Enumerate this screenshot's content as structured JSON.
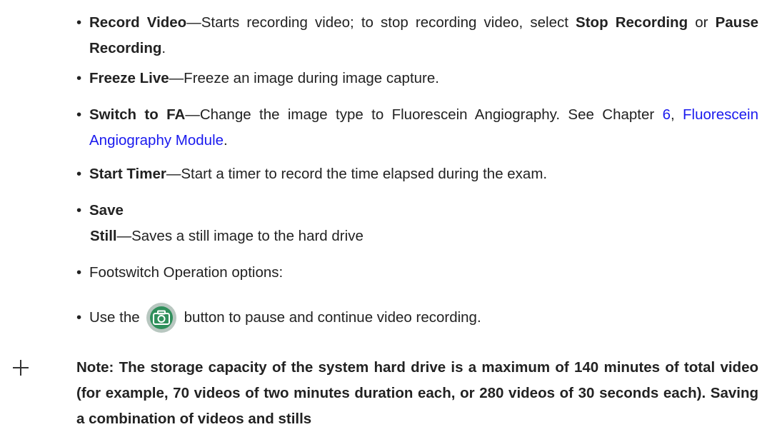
{
  "bullet_glyph": "•",
  "items": [
    {
      "term": "Record Video",
      "dash": "—",
      "text_1": "Starts recording video; to stop recording video, select ",
      "bold_1": "Stop Recording",
      "text_2": " or ",
      "bold_2": "Pause Recording",
      "text_3": "."
    },
    {
      "term": "Freeze Live",
      "dash": "—",
      "text": "Freeze an image during image capture."
    },
    {
      "term": "Switch to FA",
      "dash": "—",
      "text_1": "Change the image type to Fluorescein Angiography. See Chapter ",
      "link_chapter": "6",
      "text_2": ", ",
      "link_title": "Fluorescein Angiography Module",
      "text_3": ".",
      "link_color": "#1a1aee"
    },
    {
      "term": "Start Timer",
      "dash": "—",
      "text": "Start a timer to record the time elapsed during the exam."
    },
    {
      "term_line_1": "Save",
      "term_line_2": "Still",
      "dash": "—",
      "text": "Saves a still image to the hard drive"
    },
    {
      "text": "Footswitch Operation options:"
    }
  ],
  "sub_items": [
    {
      "text_before": "Use the ",
      "icon": "camera-icon",
      "text_after": "button to pause and continue video recording."
    }
  ],
  "note": {
    "text": "Note: The storage capacity of the system hard drive is a maximum of 140 minutes of total video (for example, 70 videos of two minutes duration each, or 280 videos of 30 seconds each). Saving a combination of videos and stills"
  },
  "colors": {
    "text": "#222222",
    "link": "#1a1aee",
    "icon_green": "#2f8f5b",
    "icon_ring": "#b8c7c0"
  }
}
